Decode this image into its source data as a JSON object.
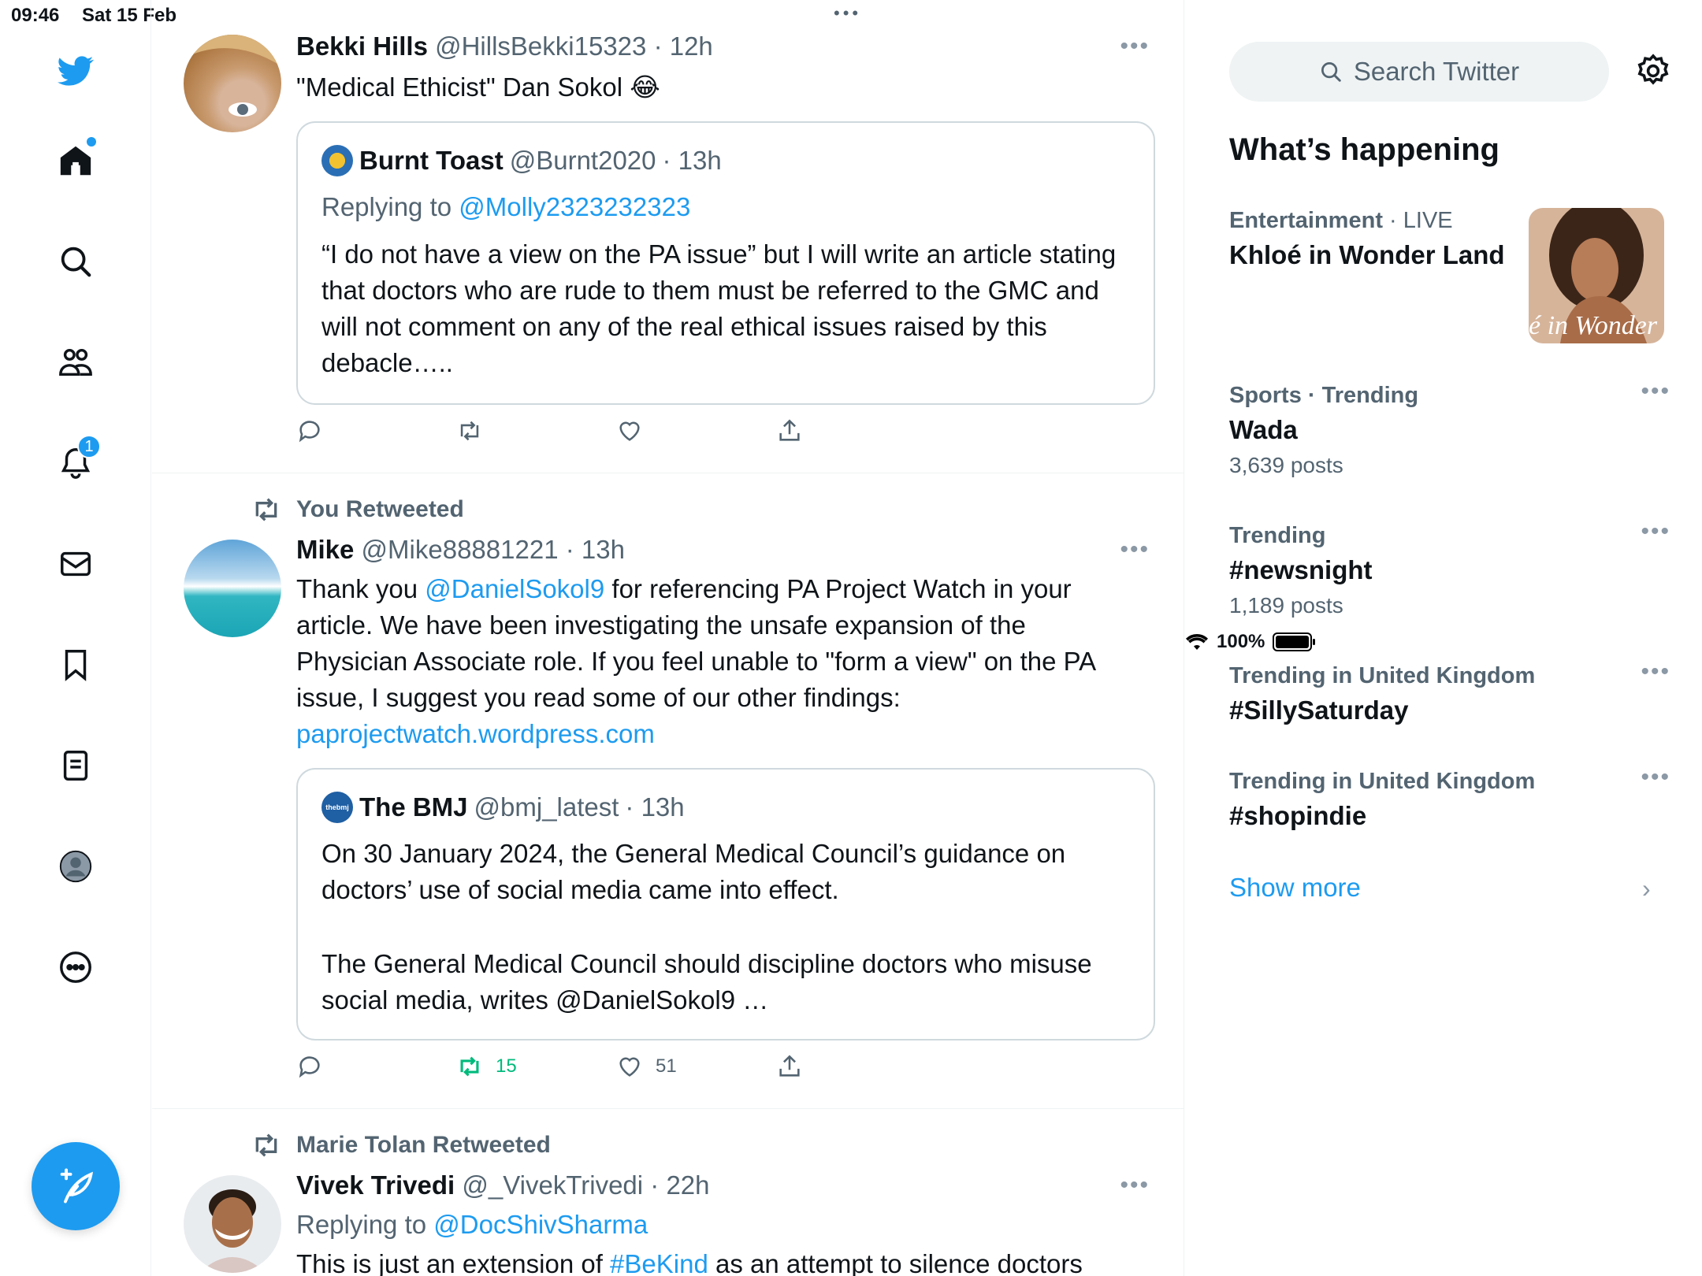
{
  "status_bar": {
    "time": "09:46",
    "date": "Sat 15 Feb",
    "battery": "100%"
  },
  "nav": {
    "notifications_badge": "1",
    "items": [
      "home-icon",
      "search-icon",
      "communities-icon",
      "bell-icon",
      "mail-icon",
      "bookmark-icon",
      "lists-icon",
      "profile-icon",
      "more-circle-icon"
    ]
  },
  "feed": {
    "tweet1": {
      "name": "Bekki Hills",
      "handle": "@HillsBekki15323",
      "time": "· 12h",
      "text": "\"Medical Ethicist\" Dan Sokol 😂",
      "quote": {
        "name": "Burnt Toast",
        "handle": "@Burnt2020",
        "time": "· 13h",
        "replying_prefix": "Replying to ",
        "replying_to": "@Molly2323232323",
        "text": "“I do not have a view on the PA issue” but I will write an article stating that doctors who are rude to them must be referred to the GMC and will not comment on any of the real ethical issues raised by this debacle….."
      }
    },
    "tweet2": {
      "retweet_label": "You Retweeted",
      "name": "Mike",
      "handle": "@Mike88881221",
      "time": "· 13h",
      "text_1": "Thank you ",
      "mention": "@DanielSokol9",
      "text_2": " for referencing PA Project Watch in your article. We have been investigating the unsafe expansion of the Physician Associate role. If you feel unable to \"form a view\" on the PA issue, I suggest you read some of our other findings:",
      "url": "paprojectwatch.wordpress.com",
      "quote": {
        "avatar_text": "thebmj",
        "name": "The BMJ",
        "handle": "@bmj_latest",
        "time": "· 13h",
        "para1": "On 30 January 2024, the General Medical Council’s guidance on doctors’ use of social media came into effect.",
        "para2": "The General Medical Council should discipline doctors who misuse social media, writes @DanielSokol9 …"
      },
      "retweets": "15",
      "likes": "51"
    },
    "tweet3": {
      "retweet_label": "Marie Tolan Retweeted",
      "name": "Vivek Trivedi",
      "handle": "@_VivekTrivedi",
      "time": "· 22h",
      "replying_prefix": "Replying to ",
      "replying_to": "@DocShivSharma",
      "text_1": "This is just an extension of ",
      "hashtag": "#BeKind",
      "text_2": " as an attempt to silence doctors"
    }
  },
  "sidebar": {
    "search_placeholder": "Search Twitter",
    "heading": "What’s happening",
    "trends": [
      {
        "category": "Entertainment",
        "live": " · LIVE",
        "title": "Khloé in Wonder Land",
        "image_text": "é in Wonder L"
      },
      {
        "category": "Sports · Trending",
        "title": "Wada",
        "count": "3,639 posts"
      },
      {
        "category": "Trending",
        "title": "#newsnight",
        "count": "1,189 posts"
      },
      {
        "category": "Trending in United Kingdom",
        "title": "#SillySaturday"
      },
      {
        "category": "Trending in United Kingdom",
        "title": "#shopindie"
      }
    ],
    "show_more": "Show more"
  },
  "colors": {
    "accent": "#1d9bf0",
    "retweet_green": "#00ba7c",
    "muted": "#536471"
  }
}
